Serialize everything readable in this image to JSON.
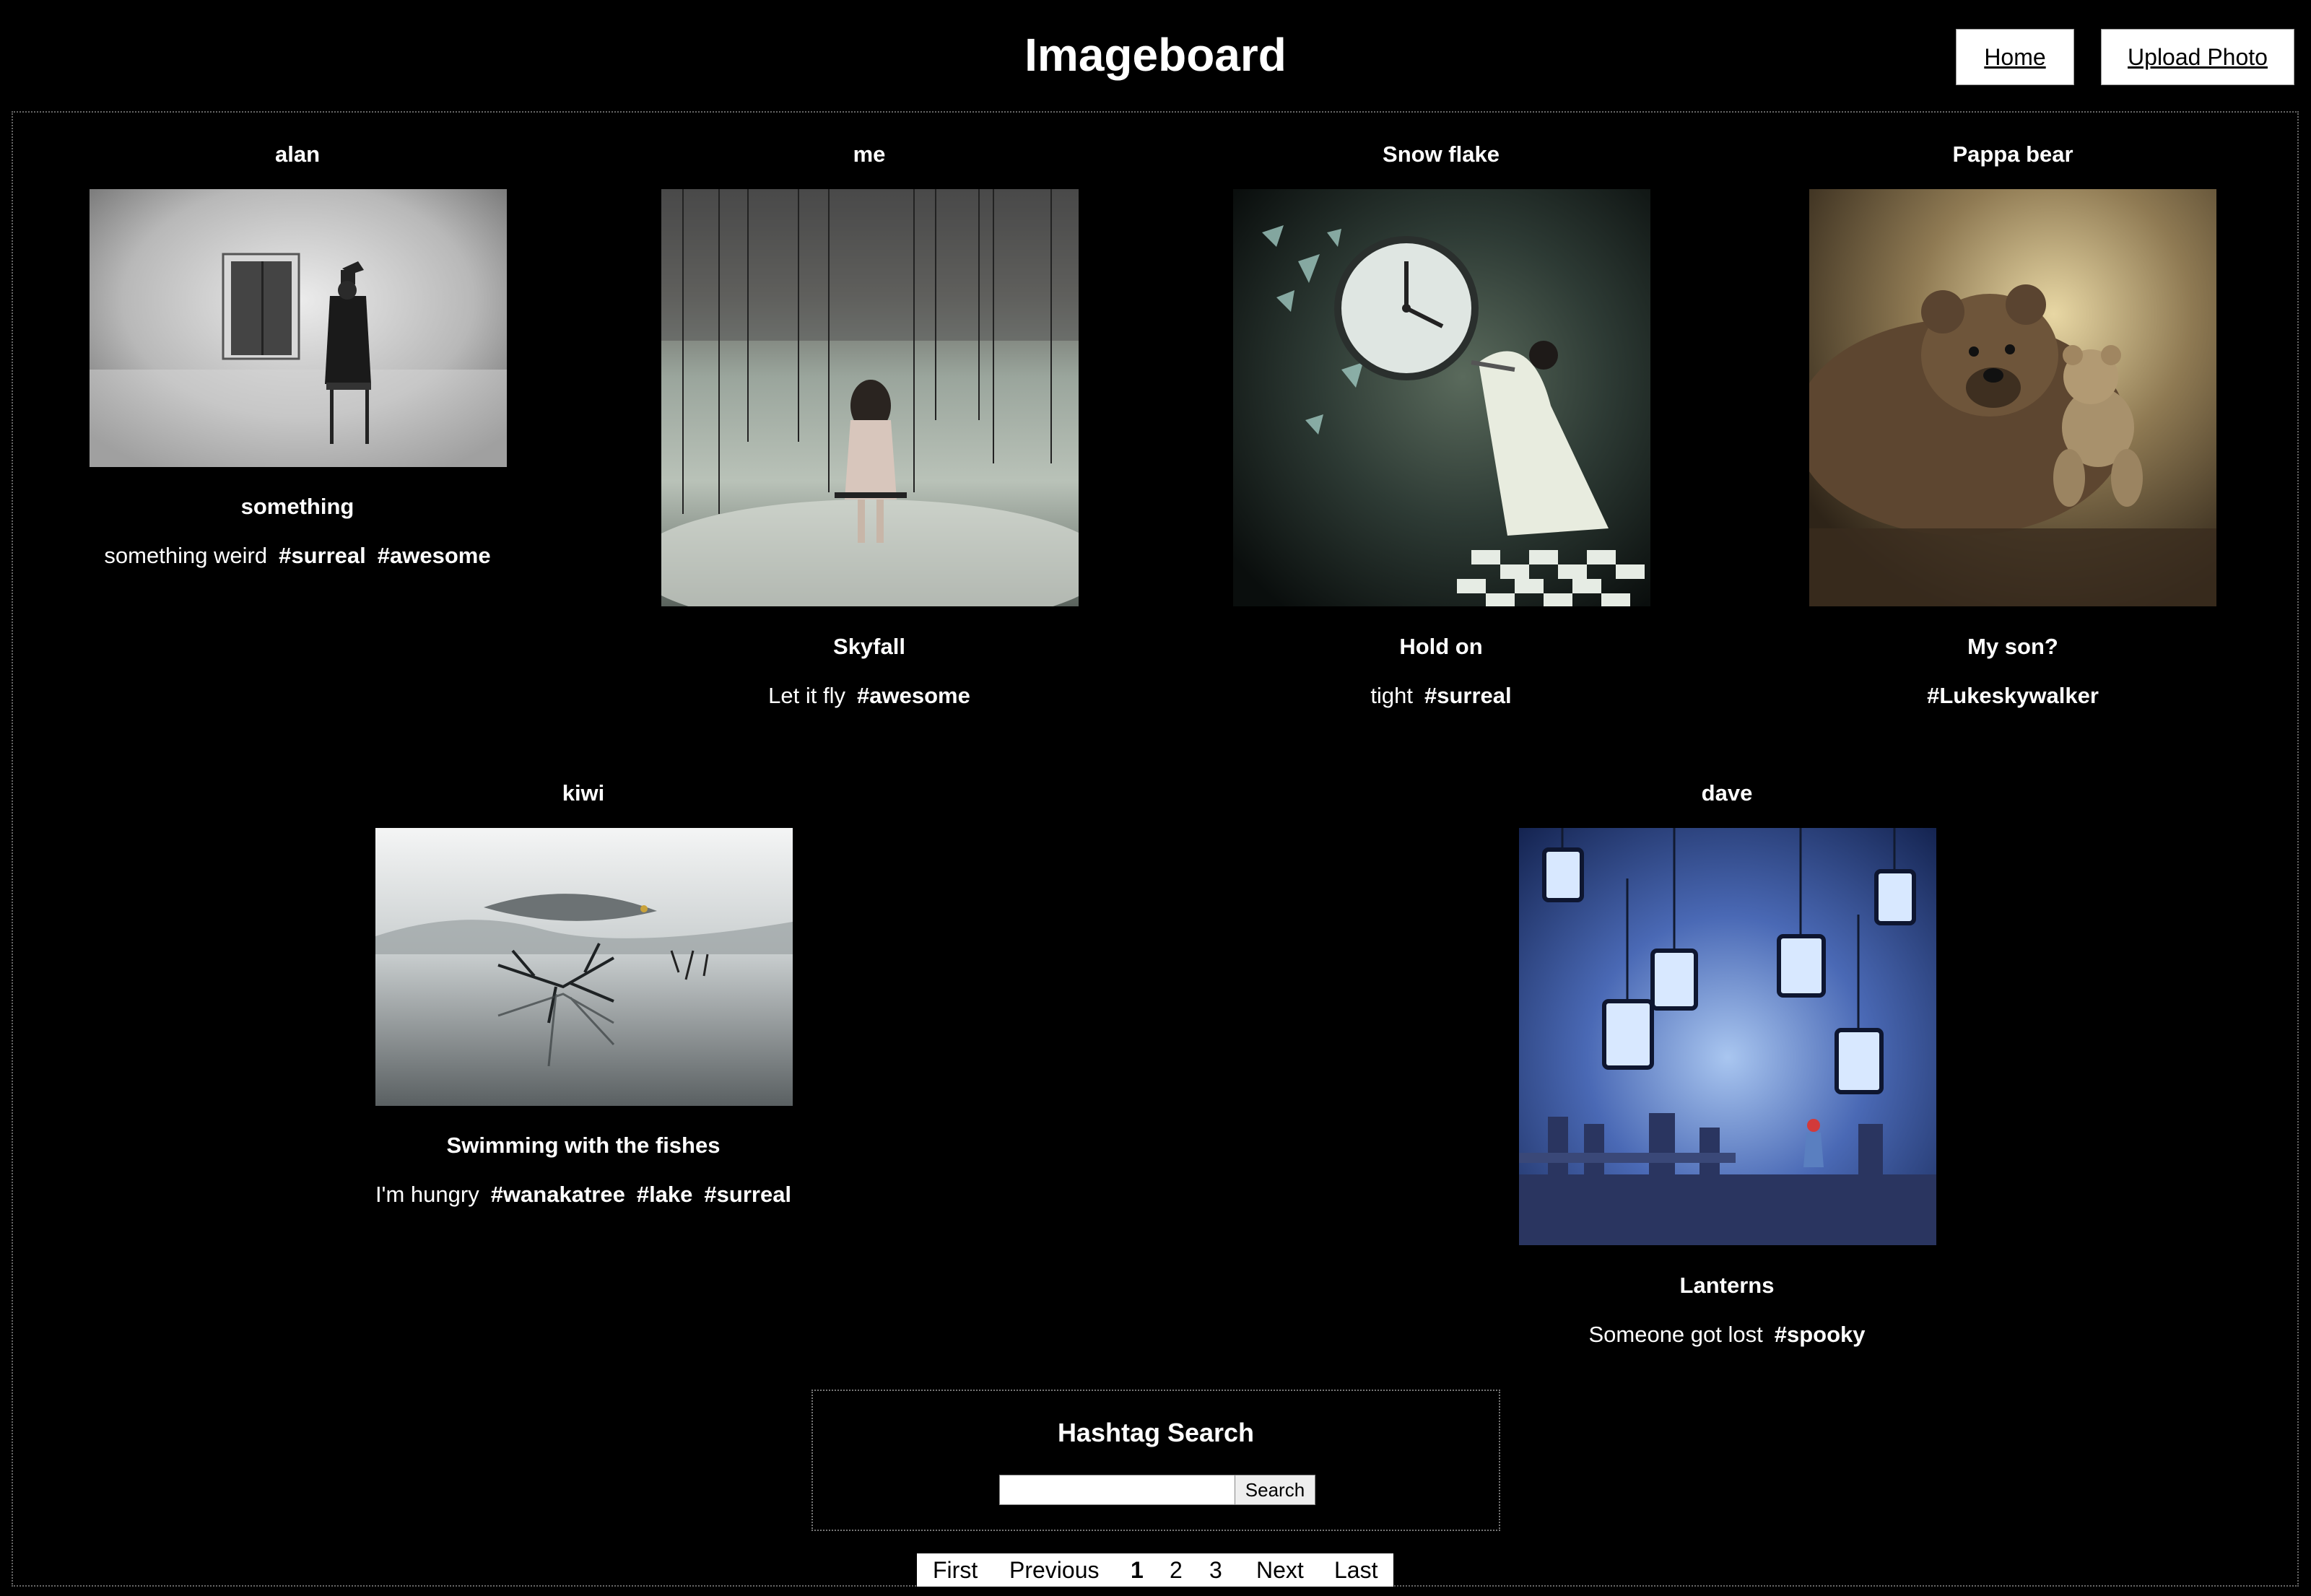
{
  "header": {
    "title": "Imageboard",
    "home_label": "Home",
    "upload_label": "Upload Photo"
  },
  "cards": [
    {
      "user": "alan",
      "title": "something",
      "description": "something weird",
      "tags": [
        "#surreal",
        "#awesome"
      ]
    },
    {
      "user": "me",
      "title": "Skyfall",
      "description": "Let it fly",
      "tags": [
        "#awesome"
      ]
    },
    {
      "user": "Snow flake",
      "title": "Hold on",
      "description": "tight",
      "tags": [
        "#surreal"
      ]
    },
    {
      "user": "Pappa bear",
      "title": "My son?",
      "description": "",
      "tags": [
        "#Lukeskywalker"
      ]
    },
    {
      "user": "kiwi",
      "title": "Swimming with the fishes",
      "description": "I'm hungry",
      "tags": [
        "#wanakatree",
        "#lake",
        "#surreal"
      ]
    },
    {
      "user": "dave",
      "title": "Lanterns",
      "description": "Someone got lost",
      "tags": [
        "#spooky"
      ]
    }
  ],
  "search": {
    "heading": "Hashtag Search",
    "input_value": "",
    "button_label": "Search"
  },
  "pagination": {
    "first": "First",
    "previous": "Previous",
    "pages": [
      "1",
      "2",
      "3"
    ],
    "current": "1",
    "next": "Next",
    "last": "Last"
  }
}
